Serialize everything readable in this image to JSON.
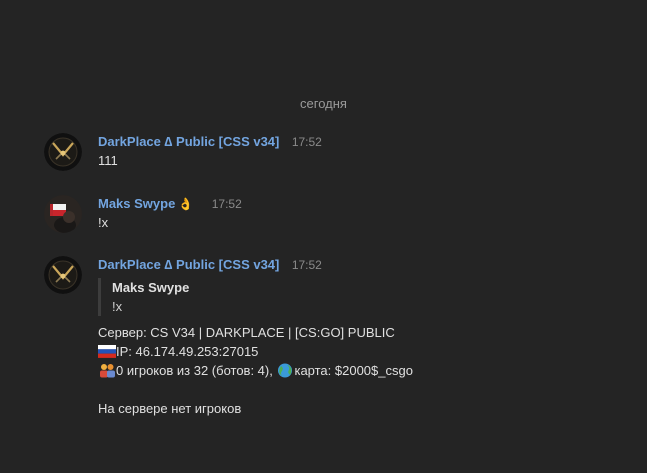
{
  "date_divider": "сегодня",
  "messages": [
    {
      "author": "DarkPlace ∆ Public [CSS v34]",
      "time": "17:52",
      "text": "111"
    },
    {
      "author": "Maks Swype",
      "author_emoji": "👌",
      "time": "17:52",
      "text": "!x"
    },
    {
      "author": "DarkPlace ∆ Public [CSS v34]",
      "time": "17:52",
      "reply": {
        "author": "Maks Swype",
        "text": "!x"
      },
      "lines": {
        "server": "Сервер: CS V34 | DARKPLACE | [CS:GO] PUBLIC",
        "ip": "IP: 46.174.49.253:27015",
        "players_a": "0 игроков из 32 (ботов: 4), ",
        "players_b": "карта: $2000$_csgo",
        "empty": "На сервере нет игроков"
      }
    }
  ],
  "icons": [
    "russia-flag-icon",
    "people-icon",
    "globe-icon",
    "ok-hand-icon"
  ],
  "colors": {
    "background": "#242424",
    "author": "#73a5e0",
    "time": "#8a8a8a",
    "text": "#e0e0e0"
  }
}
